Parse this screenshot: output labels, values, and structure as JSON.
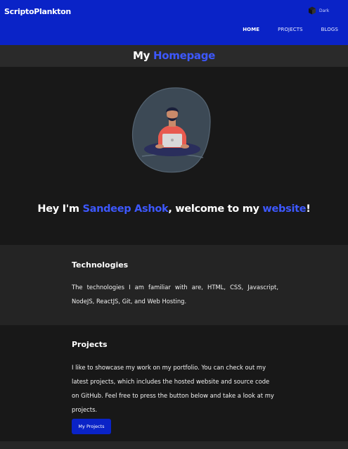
{
  "navbar": {
    "brand": "ScriptoPlankton",
    "theme_label": "Dark",
    "links": [
      {
        "label": "HOME"
      },
      {
        "label": "PROJECTS"
      },
      {
        "label": "BLOGS"
      }
    ]
  },
  "page_title": {
    "prefix": "My ",
    "accent": "Homepage"
  },
  "hero": {
    "greeting_prefix": "Hey I'm ",
    "name": "Sandeep Ashok",
    "middle": ", welcome to my ",
    "site": "website",
    "suffix": "!"
  },
  "technologies": {
    "heading": "Technologies",
    "text": "The technologies I am familiar with are, HTML, CSS, Javascript, NodeJS, ReactJS, Git, and Web Hosting."
  },
  "projects": {
    "heading": "Projects",
    "text": "I like to showcase my work on my portfolio. You can check out my latest projects, which includes the hosted website and source code on GitHub. Feel free to press the button below and take a look at my projects.",
    "button_label": "My Projects"
  },
  "colors": {
    "brand_blue": "#0a23c7",
    "accent": "#3d58ff",
    "background": "#181818"
  },
  "icons": {
    "theme": "cube-icon",
    "hero": "person-with-laptop-illustration"
  }
}
